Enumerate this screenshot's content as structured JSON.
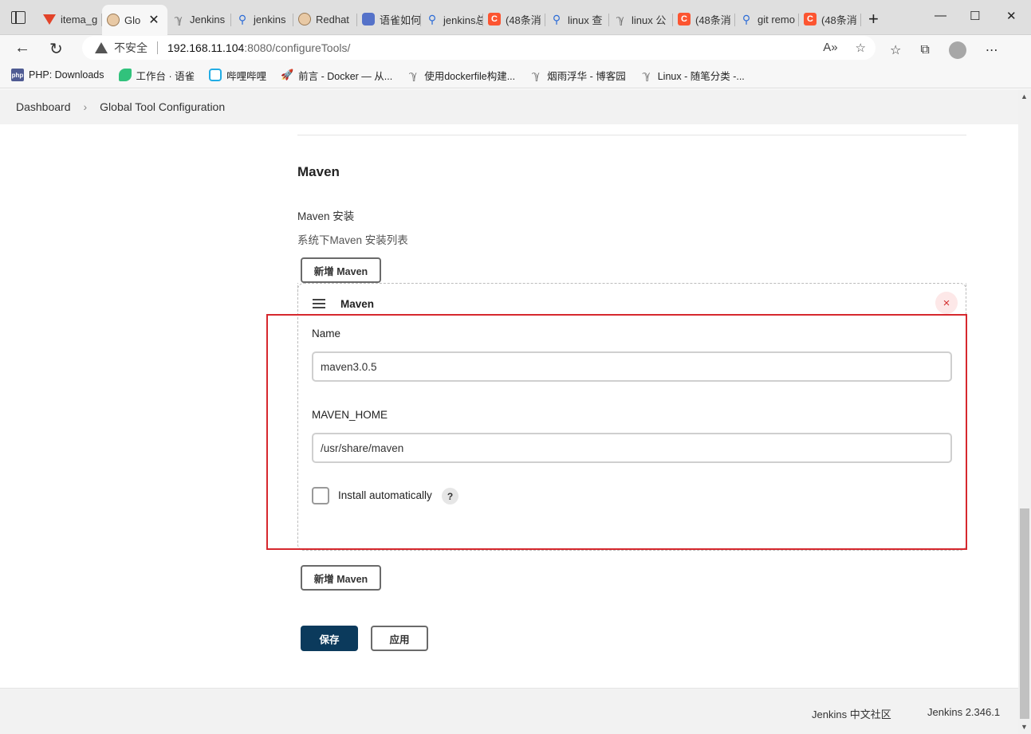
{
  "browser": {
    "tabs": [
      {
        "title": "itema_g",
        "icon": "gitlab-icon",
        "active": false
      },
      {
        "title": "Glo",
        "icon": "jenkins-icon",
        "active": true
      },
      {
        "title": "Jenkins",
        "icon": "yuque-icon",
        "active": false
      },
      {
        "title": "jenkins",
        "icon": "search-icon",
        "active": false
      },
      {
        "title": "Redhat",
        "icon": "jenkins-icon",
        "active": false
      },
      {
        "title": "语雀如何",
        "icon": "baidu-icon",
        "active": false
      },
      {
        "title": "jenkins总",
        "icon": "search-icon",
        "active": false
      },
      {
        "title": "(48条消",
        "icon": "csdn-icon",
        "active": false
      },
      {
        "title": "linux 查",
        "icon": "search-icon",
        "active": false
      },
      {
        "title": "linux 公",
        "icon": "yuque-icon",
        "active": false
      },
      {
        "title": "(48条消",
        "icon": "csdn-icon",
        "active": false
      },
      {
        "title": "git remo",
        "icon": "search-icon",
        "active": false
      },
      {
        "title": "(48条消",
        "icon": "csdn-icon",
        "active": false
      }
    ],
    "address": {
      "insecure_label": "不安全",
      "host": "192.168.11.104",
      "path": ":8080/configureTools/"
    },
    "bookmarks": [
      {
        "label": "PHP: Downloads",
        "icon": "php-icon"
      },
      {
        "label": "工作台 · 语雀",
        "icon": "yuque-icon"
      },
      {
        "label": "哔哩哔哩",
        "icon": "bilibili-icon"
      },
      {
        "label": "前言 - Docker — 从...",
        "icon": "rocket-icon"
      },
      {
        "label": "使用dockerfile构建...",
        "icon": "cnblogs-icon"
      },
      {
        "label": "烟雨浮华 - 博客园",
        "icon": "cnblogs-icon"
      },
      {
        "label": "Linux - 随笔分类 -...",
        "icon": "cnblogs-icon"
      }
    ]
  },
  "breadcrumb": {
    "dashboard": "Dashboard",
    "current": "Global Tool Configuration"
  },
  "maven_section": {
    "title": "Maven",
    "field_label": "Maven 安装",
    "field_desc": "系统下Maven 安装列表",
    "add_button": "新增 Maven",
    "installation": {
      "title": "Maven",
      "delete_symbol": "×",
      "name_label": "Name",
      "name_value": "maven3.0.5",
      "home_label": "MAVEN_HOME",
      "home_value": "/usr/share/maven",
      "install_auto_label": "Install automatically",
      "install_auto_checked": false,
      "help_symbol": "?"
    }
  },
  "actions": {
    "save": "保存",
    "apply": "应用"
  },
  "footer": {
    "community": "Jenkins 中文社区",
    "version": "Jenkins 2.346.1"
  },
  "colors": {
    "save_button": "#0b3a5c",
    "highlight_border": "#d6282e",
    "delete_icon": "#d32f2f"
  }
}
